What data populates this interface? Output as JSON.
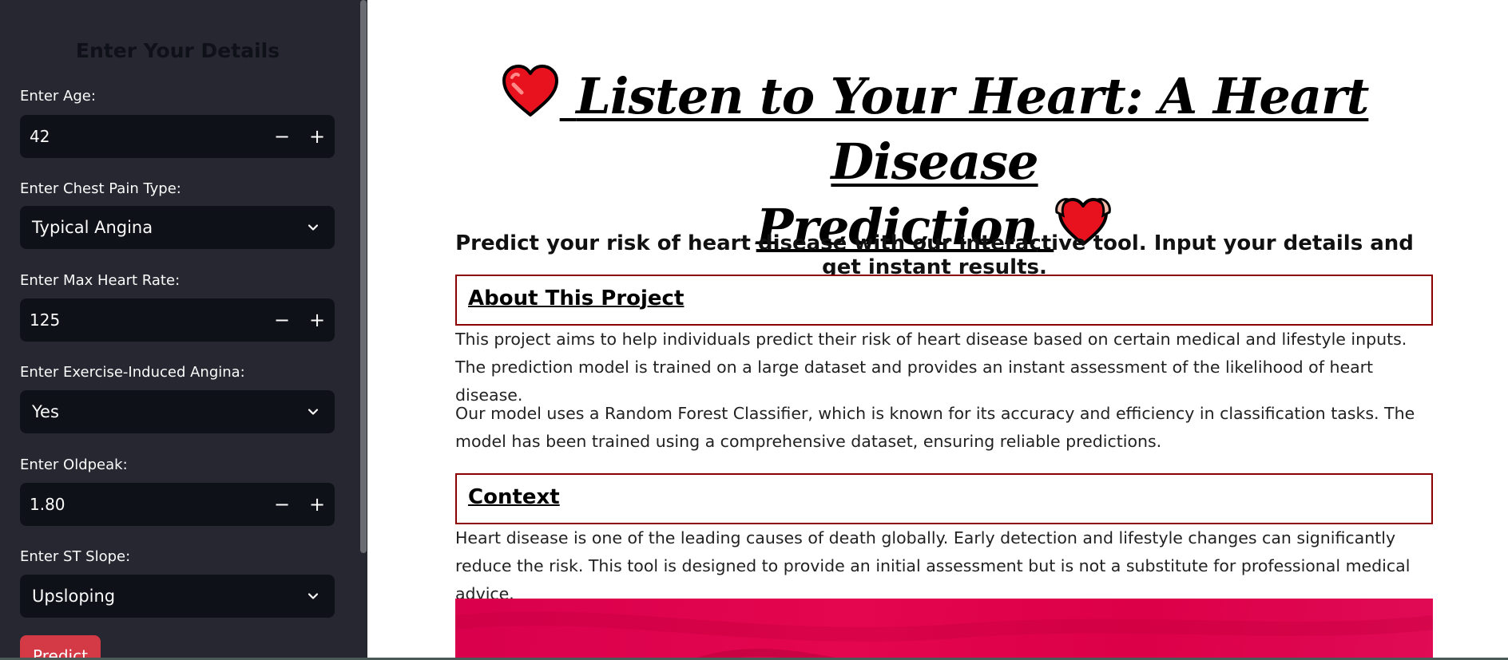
{
  "sidebar": {
    "heading": "Enter Your Details",
    "fields": [
      {
        "label": "Enter Age:",
        "type": "number",
        "value": "42"
      },
      {
        "label": "Enter Chest Pain Type:",
        "type": "select",
        "value": "Typical Angina"
      },
      {
        "label": "Enter Max Heart Rate:",
        "type": "number",
        "value": "125"
      },
      {
        "label": "Enter Exercise-Induced Angina:",
        "type": "select",
        "value": "Yes"
      },
      {
        "label": "Enter Oldpeak:",
        "type": "number",
        "value": "1.80"
      },
      {
        "label": "Enter ST Slope:",
        "type": "select",
        "value": "Upsloping"
      }
    ],
    "stepper_minus": "−",
    "stepper_plus": "+",
    "predict_label": "Predict"
  },
  "main": {
    "title_part1": "Listen to Your Heart: A Heart Disease",
    "title_part2": "Prediction",
    "subtitle": "Predict your risk of heart disease with our interactive tool. Input your details and get instant results.",
    "about": {
      "heading": "About This Project",
      "para1": "This project aims to help individuals predict their risk of heart disease based on certain medical and lifestyle inputs. The prediction model is trained on a large dataset and provides an instant assessment of the likelihood of heart disease.",
      "para2": "Our model uses a Random Forest Classifier, which is known for its accuracy and efficiency in classification tasks. The model has been trained using a comprehensive dataset, ensuring reliable predictions."
    },
    "context": {
      "heading": "Context",
      "para": "Heart disease is one of the leading causes of death globally. Early detection and lifestyle changes can significantly reduce the risk. This tool is designed to provide an initial assessment but is not a substitute for professional medical advice."
    }
  },
  "icons": {
    "title_left": "red-heart-icon",
    "title_right": "heart-hands-icon",
    "dropdown": "chevron-down-icon"
  },
  "colors": {
    "sidebar_bg": "#262730",
    "input_bg": "#0e1117",
    "predict_button": "#d33a45",
    "section_border": "#8b0000",
    "banner": "#dc0048"
  }
}
